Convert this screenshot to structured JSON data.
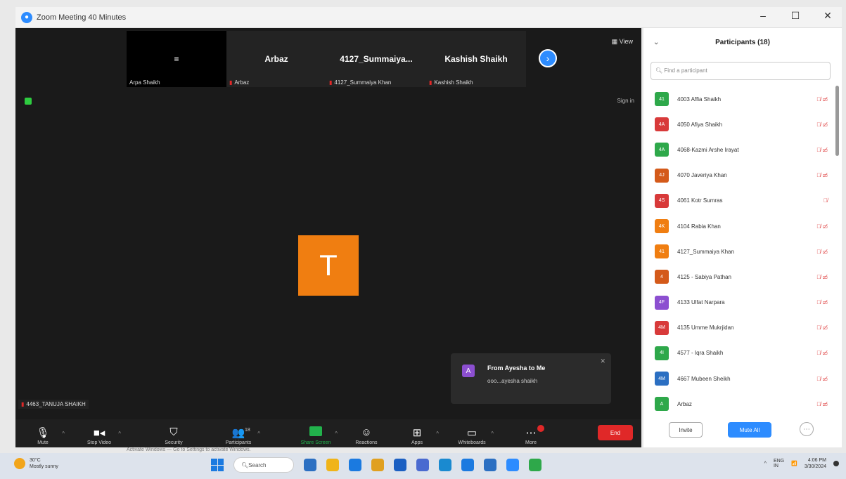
{
  "window": {
    "title": "Zoom Meeting 40 Minutes",
    "minimize": "–",
    "maximize": "☐",
    "close": "✕"
  },
  "gallery": {
    "tiles": [
      {
        "center": "≡",
        "caption": "Arpa Shaikh",
        "black": true
      },
      {
        "center": "Arbaz",
        "caption": "Arbaz"
      },
      {
        "center": "4127_Summaiya...",
        "caption": "4127_Summaiya Khan"
      },
      {
        "center": "Kashish Shaikh",
        "caption": "Kashish Shaikh"
      }
    ],
    "next": "›",
    "view": "View"
  },
  "meeting": {
    "signin": "Sign in",
    "speaker_initial": "T",
    "nameplate": "4463_TANUJA SHAIKH"
  },
  "chat_popup": {
    "avatar": "A",
    "from": "From Ayesha to Me",
    "message": "ooo...ayesha shaikh",
    "close": "✕"
  },
  "toolbar": {
    "mute": "Mute",
    "stop_video": "Stop Video",
    "security": "Security",
    "participants": "Participants",
    "participants_count": "18",
    "share_screen": "Share Screen",
    "reactions": "Reactions",
    "apps": "Apps",
    "whiteboards": "Whiteboards",
    "more": "More",
    "end": "End"
  },
  "panel": {
    "title": "Participants (18)",
    "collapse": "⌄",
    "search_placeholder": "Find a participant",
    "participants": [
      {
        "initials": "41",
        "name": "4003 Affia Shaikh",
        "color": "#2ea84a",
        "icons": "🎙̸ ▭̸"
      },
      {
        "initials": "4A",
        "name": "4050 Afiya Shaikh",
        "color": "#d83a3a",
        "icons": "🎙̸ ▭̸"
      },
      {
        "initials": "4A",
        "name": "4068-Kazmi Arshe Irayat",
        "color": "#2ea84a",
        "icons": "🎙̸ ▭̸"
      },
      {
        "initials": "4J",
        "name": "4070 Javeriya Khan",
        "color": "#d45a1a",
        "icons": "🎙̸ ▭̸"
      },
      {
        "initials": "4S",
        "name": "4061 Kotr Sumras",
        "color": "#d83a3a",
        "icons": "🎙̸"
      },
      {
        "initials": "4K",
        "name": "4104 Rabia Khan",
        "color": "#f07e11",
        "icons": "🎙̸ ▭̸"
      },
      {
        "initials": "41",
        "name": "4127_Summaiya Khan",
        "color": "#f07e11",
        "icons": "🎙̸ ▭̸"
      },
      {
        "initials": "4",
        "name": "4125 - Sabiya Pathan",
        "color": "#d45a1a",
        "icons": "🎙̸ ▭̸"
      },
      {
        "initials": "4F",
        "name": "4133 Ulfat Narpara",
        "color": "#8c4fd0",
        "icons": "🎙̸ ▭̸"
      },
      {
        "initials": "4M",
        "name": "4135 Umme Mukrjidan",
        "color": "#d83a3a",
        "icons": "🎙̸ ▭̸"
      },
      {
        "initials": "4I",
        "name": "4577 - Iqra Shaikh",
        "color": "#2ea84a",
        "icons": "🎙̸ ▭̸"
      },
      {
        "initials": "4M",
        "name": "4667 Mubeen Sheikh",
        "color": "#2b6fc2",
        "icons": "🎙̸ ▭̸"
      },
      {
        "initials": "A",
        "name": "Arbaz",
        "color": "#2ea84a",
        "icons": "🎙̸ ▭̸"
      }
    ],
    "invite": "Invite",
    "mute_all": "Mute All",
    "more": "⋯"
  },
  "below_text": "Activate Windows — Go to Settings to activate Windows.",
  "taskbar": {
    "weather_temp": "30°C",
    "weather_desc": "Mostly sunny",
    "search": "Search",
    "lang": "ENG",
    "region": "IN",
    "time": "4:06 PM",
    "date": "3/30/2024",
    "app_colors": [
      "#2b6fc2",
      "#f0b419",
      "#1b7ae0",
      "#e0a020",
      "#1b5fc2",
      "#4a6ad0",
      "#1a8ad0",
      "#1b7ae0",
      "#2b6fc2",
      "#2d8cff",
      "#2ea84a"
    ]
  }
}
